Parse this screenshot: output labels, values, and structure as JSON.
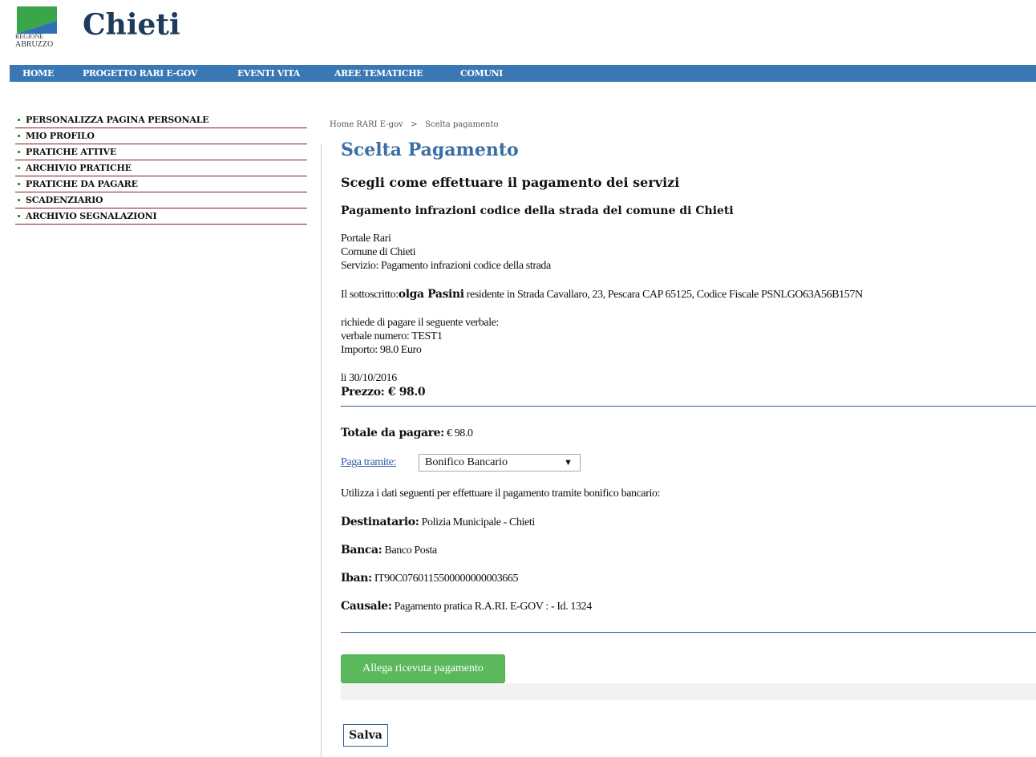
{
  "header": {
    "logo_line1": "REGIONE",
    "logo_line2": "ABRUZZO",
    "site_title": "Chieti"
  },
  "nav": {
    "items": [
      "HOME",
      "PROGETTO RARI E-GOV",
      "EVENTI VITA",
      "AREE TEMATICHE",
      "COMUNI"
    ]
  },
  "sidebar": {
    "items": [
      "PERSONALIZZA PAGINA PERSONALE",
      "MIO PROFILO",
      "PRATICHE ATTIVE",
      "ARCHIVIO PRATICHE",
      "PRATICHE DA PAGARE",
      "SCADENZIARIO",
      "ARCHIVIO SEGNALAZIONI"
    ]
  },
  "breadcrumb": {
    "home": "Home RARI E-gov",
    "separator": ">",
    "current": "Scelta pagamento"
  },
  "main": {
    "page_title": "Scelta Pagamento",
    "subtitle": "Scegli come effettuare il pagamento dei servizi",
    "service_title": "Pagamento infrazioni codice della strada del comune di Chieti",
    "portal_line": "Portale Rari",
    "comune_line": "Comune di Chieti",
    "service_line": "Servizio: Pagamento infrazioni codice della strada",
    "signer_prefix": "Il sottoscritto:",
    "signer_name": "olga Pasini",
    "signer_details": " residente in Strada Cavallaro, 23, Pescara CAP 65125, Codice Fiscale PSNLGO63A56B157N",
    "request_line": "richiede di pagare il seguente verbale:",
    "verbale_line": "verbale numero: TEST1",
    "importo_line": "Importo: 98.0 Euro",
    "date_line": "li 30/10/2016",
    "price_label": "Prezzo: € 98.0",
    "total_label": "Totale da pagare:",
    "total_value": " € 98.0",
    "pay_via_label": "Paga tramite:",
    "pay_via_selected": "Bonifico Bancario",
    "instructions": "Utilizza i dati seguenti per effettuare il pagamento tramite bonifico bancario:",
    "recipient_label": "Destinatario:",
    "recipient_value": " Polizia Municipale - Chieti",
    "bank_label": "Banca:",
    "bank_value": " Banco Posta",
    "iban_label": "Iban:",
    "iban_value": " IT90C0760115500000000003665",
    "causale_label": "Causale:",
    "causale_value": " Pagamento pratica R.A.RI. E-GOV : - Id. 1324",
    "attach_button": "Allega ricevuta pagamento",
    "save_button": "Salva"
  },
  "colors": {
    "nav_bg": "#3a78b5",
    "title_blue": "#3a6ea5",
    "sidebar_rule": "#8a1a1a",
    "button_green": "#5cb85c",
    "logo_green": "#3aa64a",
    "logo_blue": "#2e6fb5"
  }
}
